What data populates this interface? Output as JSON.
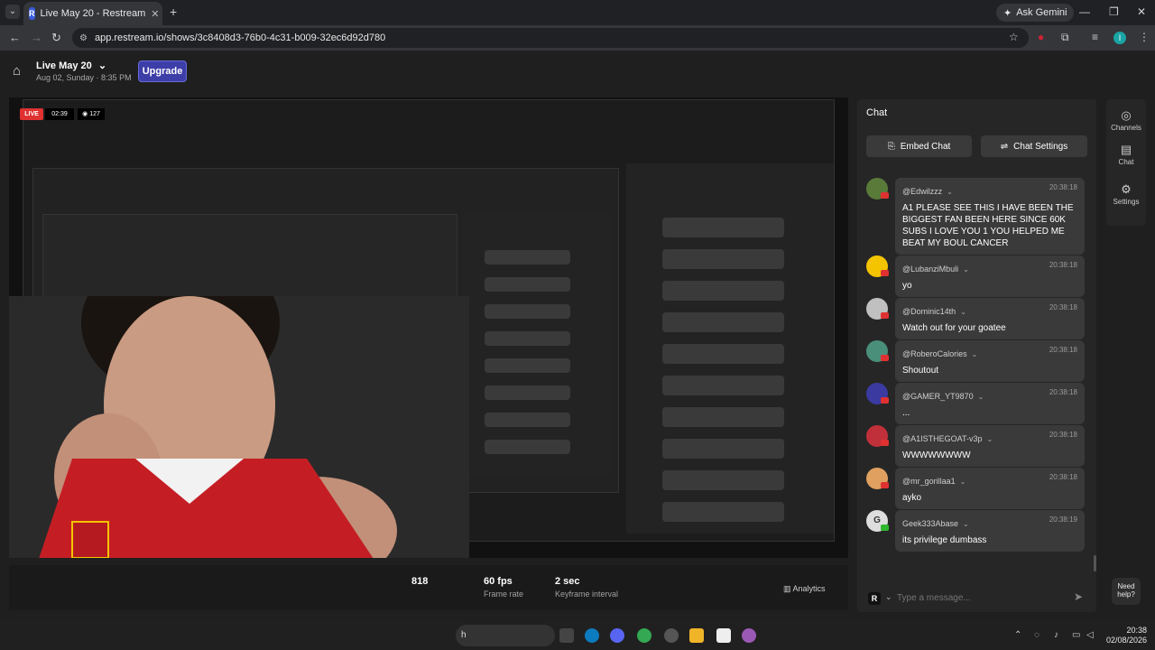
{
  "browser": {
    "tab_menu": "⌄",
    "tab_favicon": "R",
    "tab_title": "Live May 20 - Restream",
    "tab_close": "✕",
    "new_tab": "+",
    "gemini_label": "Ask Gemini",
    "url": "app.restream.io/shows/3c8408d3-76b0-4c31-b009-32ec6d92d780",
    "profile_initial": "I"
  },
  "header": {
    "title": "Live May 20",
    "chevron": "⌄",
    "date": "Aug 02, Sunday · 8:35 PM",
    "upgrade": "Upgrade"
  },
  "stage": {
    "live": "LIVE",
    "timer": "02:39",
    "viewers": "127"
  },
  "stats": {
    "bitrate": "818",
    "fps_value": "60 fps",
    "fps_label": "Frame rate",
    "keyframe_value": "2 sec",
    "keyframe_label": "Keyframe interval",
    "analytics": "Analytics"
  },
  "chat": {
    "title": "Chat",
    "embed_chat": "Embed Chat",
    "chat_settings": "Chat Settings",
    "input_placeholder": "Type a message...",
    "platform_letter": "R",
    "messages": [
      {
        "user": "@Edwilzzz",
        "time": "20:38:18",
        "text": "A1 PLEASE SEE THIS I HAVE BEEN THE BIGGEST FAN BEEN HERE SINCE 60K SUBS I LOVE YOU 1 YOU HELPED ME BEAT MY BOUL CANCER",
        "avatar_color": "#5a7a3a"
      },
      {
        "user": "@LubanziMbuli",
        "time": "20:38:18",
        "text": "yo",
        "avatar_color": "#f5c400"
      },
      {
        "user": "@Dominic14th",
        "time": "20:38:18",
        "text": "Watch out for your goatee",
        "avatar_color": "#c0c0c0"
      },
      {
        "user": "@RoberoCalories",
        "time": "20:38:18",
        "text": "Shoutout",
        "avatar_color": "#4a8f7a"
      },
      {
        "user": "@GAMER_YT9870",
        "time": "20:38:18",
        "text": "...",
        "avatar_color": "#3a3aa0"
      },
      {
        "user": "@A1ISTHEGOAT-v3p",
        "time": "20:38:18",
        "text": "WWWWWWWW",
        "avatar_color": "#c0303a"
      },
      {
        "user": "@mr_gorillaa1",
        "time": "20:38:18",
        "text": "ayko",
        "avatar_color": "#e0a060"
      },
      {
        "user": "Geek333Abase",
        "time": "20:38:19",
        "text": "its privilege dumbass",
        "avatar_color": "#dddddd",
        "avatar_letter": "G"
      }
    ]
  },
  "rail": {
    "channels": "Channels",
    "chat": "Chat",
    "settings": "Settings"
  },
  "help": "Need help?",
  "taskbar": {
    "search_text": "h",
    "time": "20:38",
    "date": "02/08/2026"
  }
}
